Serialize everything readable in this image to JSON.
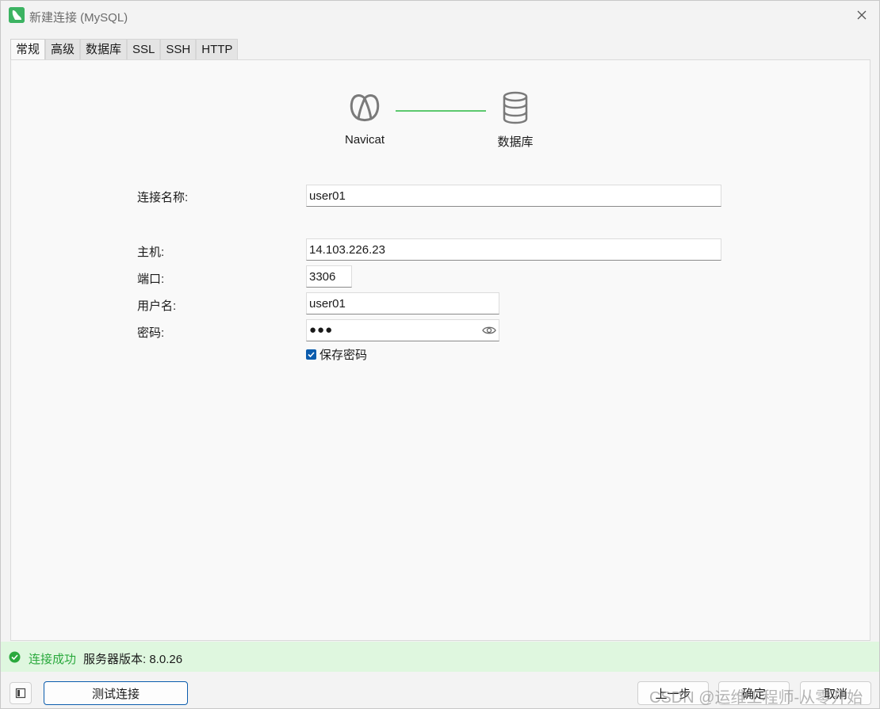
{
  "window": {
    "title": "新建连接 (MySQL)"
  },
  "tabs": [
    {
      "label": "常规",
      "active": true
    },
    {
      "label": "高级",
      "active": false
    },
    {
      "label": "数据库",
      "active": false
    },
    {
      "label": "SSL",
      "active": false
    },
    {
      "label": "SSH",
      "active": false
    },
    {
      "label": "HTTP",
      "active": false
    }
  ],
  "diagram": {
    "left_label": "Navicat",
    "right_label": "数据库",
    "line_color": "#5cc96e"
  },
  "form": {
    "connection_name_label": "连接名称:",
    "connection_name_value": "user01",
    "host_label": "主机:",
    "host_value": "14.103.226.23",
    "port_label": "端口:",
    "port_value": "3306",
    "username_label": "用户名:",
    "username_value": "user01",
    "password_label": "密码:",
    "password_mask": "●●●",
    "save_password_label": "保存密码",
    "save_password_checked": true
  },
  "status": {
    "ok_text": "连接成功",
    "server_version_text": "服务器版本: 8.0.26",
    "color": "#2aa93d"
  },
  "buttons": {
    "test_connection": "测试连接",
    "prev": "上一步",
    "ok": "确定",
    "cancel": "取消"
  },
  "watermark": "CSDN @运维工程师-从零开始",
  "colors": {
    "accent": "#0b5cad",
    "status_bg": "#dff7df"
  }
}
